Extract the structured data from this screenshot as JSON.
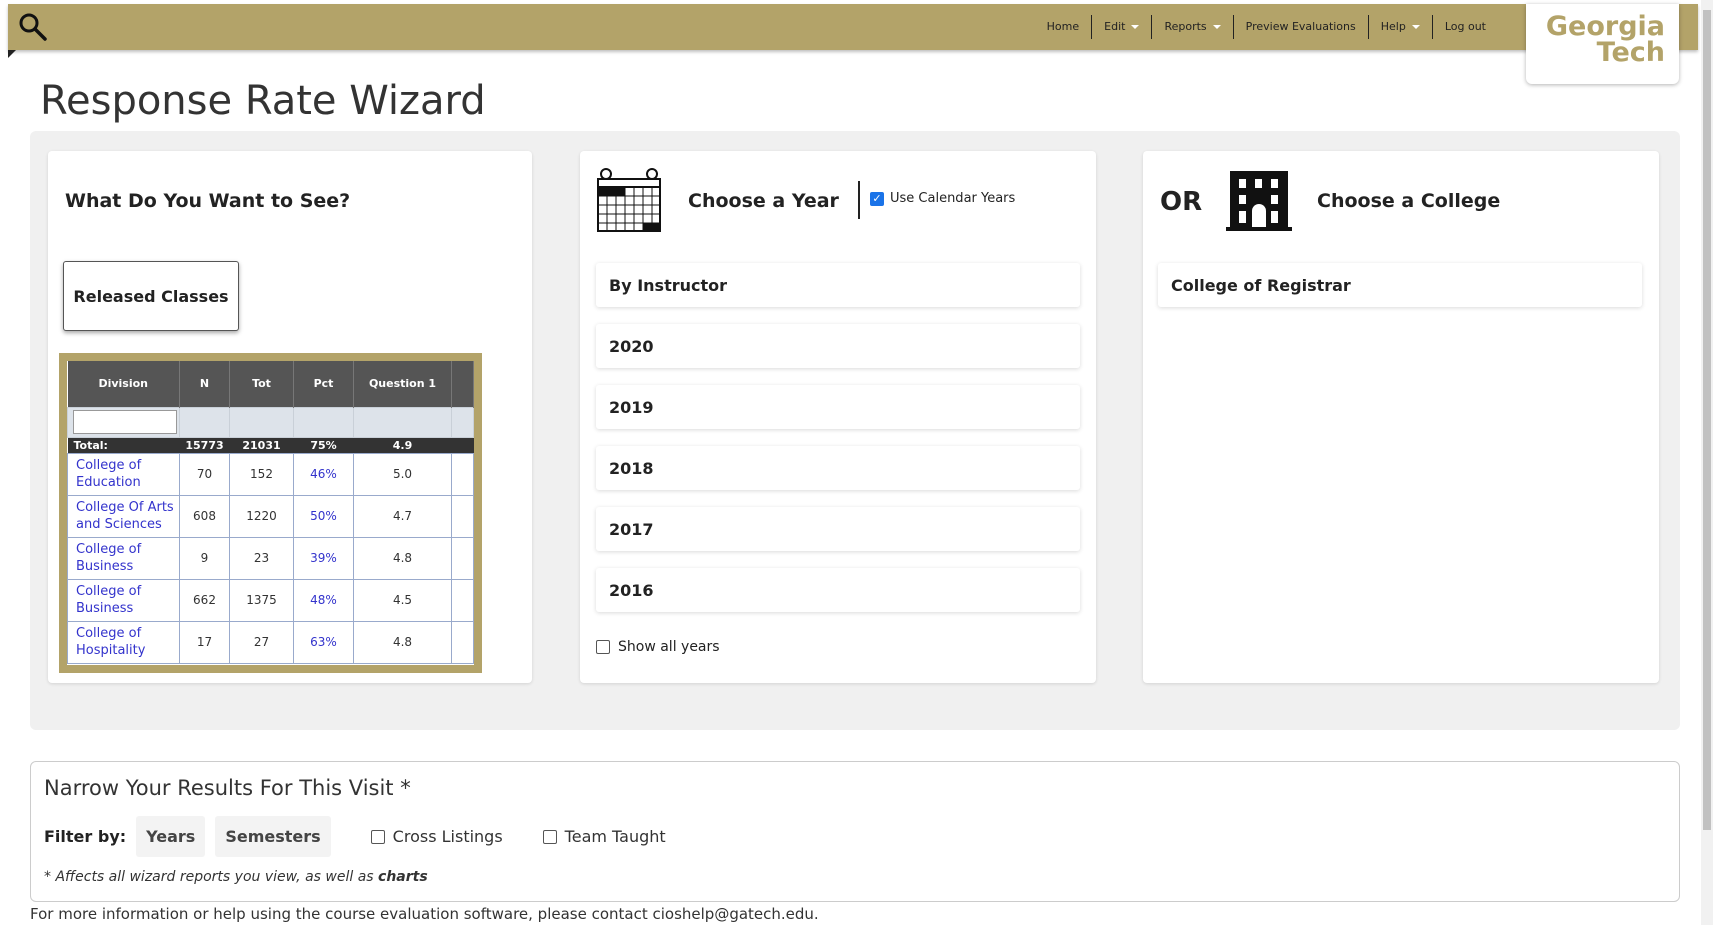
{
  "nav": {
    "items": [
      {
        "label": "Home",
        "caret": false
      },
      {
        "label": "Edit",
        "caret": true
      },
      {
        "label": "Reports",
        "caret": true
      },
      {
        "label": "Preview Evaluations",
        "caret": false
      },
      {
        "label": "Help",
        "caret": true
      },
      {
        "label": "Log out",
        "caret": false
      }
    ],
    "logo_line1": "Georgia",
    "logo_line2": "Tech"
  },
  "page_title": "Response Rate Wizard",
  "what_card": {
    "title": "What Do You Want to See?",
    "button_label": "Released Classes",
    "preview_table": {
      "headers": [
        "Division",
        "N",
        "Tot",
        "Pct",
        "Question 1"
      ],
      "total": [
        "Total:",
        "15773",
        "21031",
        "75%",
        "4.9"
      ],
      "rows": [
        {
          "division": "College of Education",
          "n": "70",
          "tot": "152",
          "pct": "46%",
          "q1": "5.0"
        },
        {
          "division": "College Of Arts and Sciences",
          "n": "608",
          "tot": "1220",
          "pct": "50%",
          "q1": "4.7"
        },
        {
          "division": "College of Business",
          "n": "9",
          "tot": "23",
          "pct": "39%",
          "q1": "4.8"
        },
        {
          "division": "College of Business",
          "n": "662",
          "tot": "1375",
          "pct": "48%",
          "q1": "4.5"
        },
        {
          "division": "College of Hospitality",
          "n": "17",
          "tot": "27",
          "pct": "63%",
          "q1": "4.8"
        }
      ]
    }
  },
  "year_card": {
    "title": "Choose a Year",
    "calendar_checkbox_label": "Use Calendar Years",
    "calendar_checked": true,
    "items": [
      "By Instructor",
      "2020",
      "2019",
      "2018",
      "2017",
      "2016"
    ],
    "show_all_label": "Show all years"
  },
  "college_card": {
    "or_label": "OR",
    "title": "Choose a College",
    "items": [
      "College of Registrar"
    ]
  },
  "narrow": {
    "title": "Narrow Your Results For This Visit *",
    "filter_label": "Filter by:",
    "chips": [
      "Years",
      "Semesters"
    ],
    "checkboxes": [
      "Cross Listings",
      "Team Taught"
    ],
    "note_text": "* Affects all wizard reports you view, as well as ",
    "note_bold": "charts"
  },
  "footer": "For more information or help using the course evaluation software, please contact cioshelp@gatech.edu.",
  "colors": {
    "gold": "#b3a369",
    "link": "#3333cc",
    "checkbox": "#1a73e8"
  }
}
